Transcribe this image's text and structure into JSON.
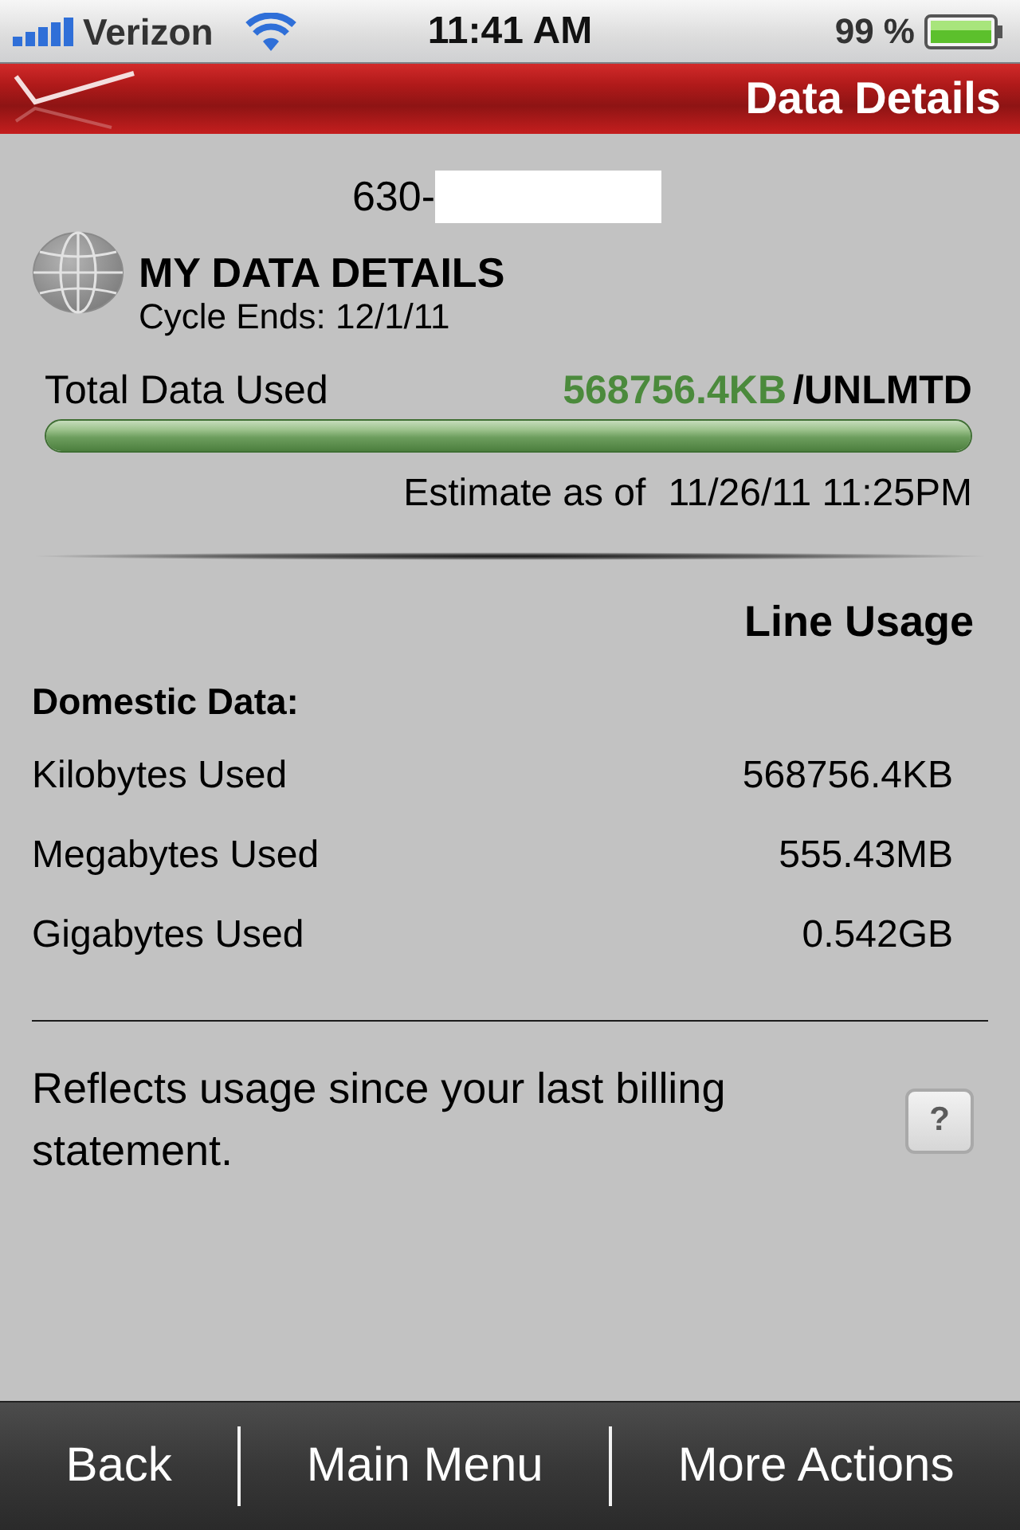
{
  "status_bar": {
    "carrier": "Verizon",
    "time": "11:41 AM",
    "battery": "99 %"
  },
  "header": {
    "title": "Data Details"
  },
  "account": {
    "number": "630-"
  },
  "summary": {
    "title": "MY DATA DETAILS",
    "cycle": "Cycle Ends: 12/1/11",
    "label": "Total Data Used",
    "used": "568756.4KB",
    "limit": "/UNLMTD",
    "level": 1,
    "estimate_label": "Estimate as of",
    "estimate_time": "11/26/11 11:25PM"
  },
  "usage": {
    "title": "Line Usage",
    "section": "Domestic Data:",
    "rows": [
      {
        "label": "Kilobytes Used",
        "value": "568756.4KB"
      },
      {
        "label": "Megabytes Used",
        "value": "555.43MB"
      },
      {
        "label": "Gigabytes Used",
        "value": "0.542GB"
      }
    ]
  },
  "note": {
    "text": "Reflects usage since your last billing statement.",
    "help": "?"
  },
  "toolbar": {
    "buttons": [
      "Back",
      "Main Menu",
      "More Actions"
    ]
  }
}
